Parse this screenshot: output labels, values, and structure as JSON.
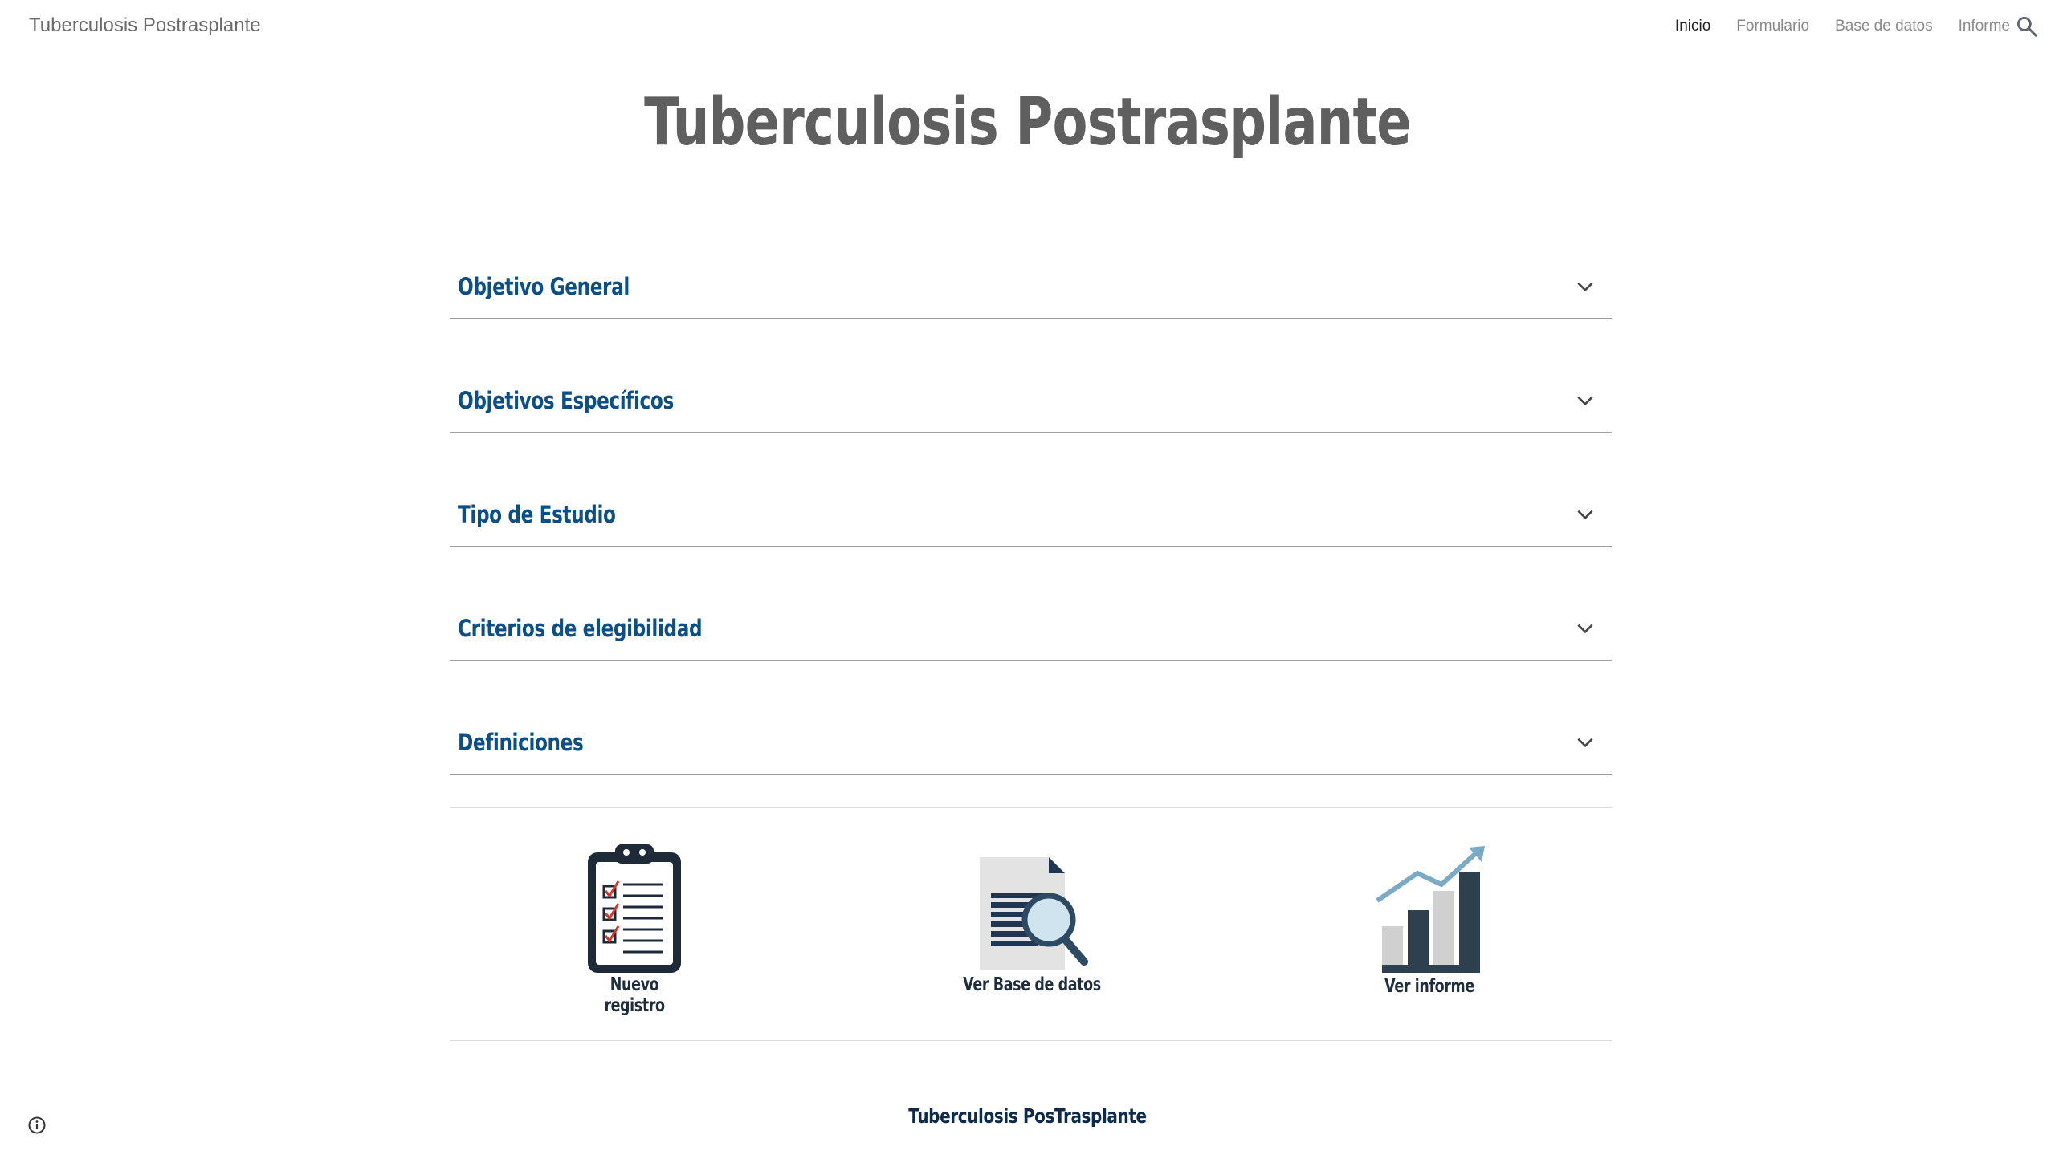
{
  "header": {
    "site_title": "Tuberculosis Postrasplante",
    "nav": [
      {
        "label": "Inicio",
        "active": true
      },
      {
        "label": "Formulario",
        "active": false
      },
      {
        "label": "Base de datos",
        "active": false
      },
      {
        "label": "Informe",
        "active": false
      }
    ],
    "search_icon": "search-icon"
  },
  "hero": {
    "title": "Tuberculosis Postrasplante"
  },
  "accordion": [
    {
      "label": "Objetivo General",
      "icon": "chevron-down-icon"
    },
    {
      "label": "Objetivos Específicos",
      "icon": "chevron-down-icon"
    },
    {
      "label": "Tipo de Estudio",
      "icon": "chevron-down-icon"
    },
    {
      "label": "Criterios de elegibilidad",
      "icon": "chevron-down-icon"
    },
    {
      "label": "Definiciones",
      "icon": "chevron-down-icon"
    }
  ],
  "tiles": [
    {
      "label": "Nuevo registro",
      "icon": "clipboard-checklist-icon"
    },
    {
      "label": "Ver Base de datos",
      "icon": "document-search-icon"
    },
    {
      "label": "Ver informe",
      "icon": "bar-chart-growth-icon"
    }
  ],
  "footer": {
    "text": "Tuberculosis PosTrasplante",
    "info_icon": "info-icon"
  },
  "colors": {
    "accordion_label": "#0b4f86",
    "hero_title": "#5f5f5f",
    "icon_dark": "#1f3a4d",
    "icon_accent_blue": "#7aaac6",
    "icon_check_red": "#d9342b"
  }
}
